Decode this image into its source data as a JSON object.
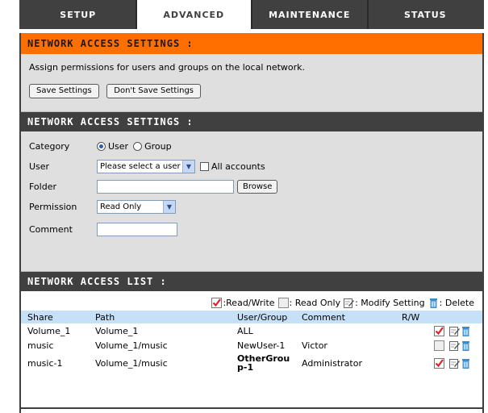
{
  "tabs": [
    {
      "label": "SETUP",
      "active": false
    },
    {
      "label": "ADVANCED",
      "active": true
    },
    {
      "label": "MAINTENANCE",
      "active": false
    },
    {
      "label": "STATUS",
      "active": false
    }
  ],
  "intro": {
    "title": "NETWORK ACCESS SETTINGS :",
    "description": "Assign permissions for users and groups on the local network.",
    "save_label": "Save Settings",
    "dont_save_label": "Don't Save Settings"
  },
  "form": {
    "title": "NETWORK ACCESS SETTINGS :",
    "category_label": "Category",
    "category_user": "User",
    "category_group": "Group",
    "category_selected": "User",
    "user_label": "User",
    "user_select_value": "Please select a user",
    "all_accounts_label": "All accounts",
    "folder_label": "Folder",
    "folder_value": "",
    "browse_label": "Browse",
    "permission_label": "Permission",
    "permission_value": "Read Only",
    "comment_label": "Comment",
    "comment_value": ""
  },
  "list": {
    "title": "NETWORK ACCESS LIST :",
    "legend": {
      "read_write": ":Read/Write",
      "read_only": ": Read Only",
      "modify": ": Modify Setting",
      "delete": ": Delete"
    },
    "headers": {
      "share": "Share",
      "path": "Path",
      "user_group": "User/Group",
      "comment": "Comment",
      "rw": "R/W"
    },
    "rows": [
      {
        "share": "Volume_1",
        "path": "Volume_1",
        "user_group": "ALL",
        "comment": "",
        "rw": "read-write",
        "group": false
      },
      {
        "share": "music",
        "path": "Volume_1/music",
        "user_group": "NewUser-1",
        "comment": "Victor",
        "rw": "read-only",
        "group": false
      },
      {
        "share": "music-1",
        "path": "Volume_1/music",
        "user_group": "OtherGroup-1",
        "comment": "Administrator",
        "rw": "read-write",
        "group": true
      }
    ]
  },
  "colors": {
    "tab_bar": "#404040",
    "orange_header": "#ff6f00",
    "panel_bg": "#dfdfdf",
    "table_header": "#c6e0f7"
  },
  "icons": {
    "read_write": "checked-box-icon",
    "read_only": "empty-box-icon",
    "modify": "edit-icon",
    "delete": "trash-icon"
  }
}
